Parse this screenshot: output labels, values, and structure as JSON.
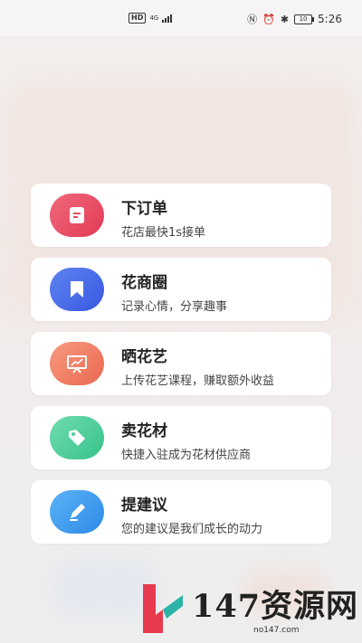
{
  "status_bar": {
    "network": "HD",
    "signal": "4G",
    "battery": "10",
    "time": "5:26"
  },
  "menu": {
    "items": [
      {
        "title": "下订单",
        "subtitle": "花店最快1s接单",
        "icon": "order-icon",
        "color": "#e84a62"
      },
      {
        "title": "花商圈",
        "subtitle": "记录心情，分享趣事",
        "icon": "bookmark-icon",
        "color": "#4766e8"
      },
      {
        "title": "晒花艺",
        "subtitle": "上传花艺课程，赚取额外收益",
        "icon": "presentation-icon",
        "color": "#f07a64"
      },
      {
        "title": "卖花材",
        "subtitle": "快捷入驻成为花材供应商",
        "icon": "tag-icon",
        "color": "#4ecf99"
      },
      {
        "title": "提建议",
        "subtitle": "您的建议是我们成长的动力",
        "icon": "pen-icon",
        "color": "#3d9cf0"
      }
    ]
  },
  "watermark": {
    "text": "147资源网",
    "url": "no147.com"
  }
}
